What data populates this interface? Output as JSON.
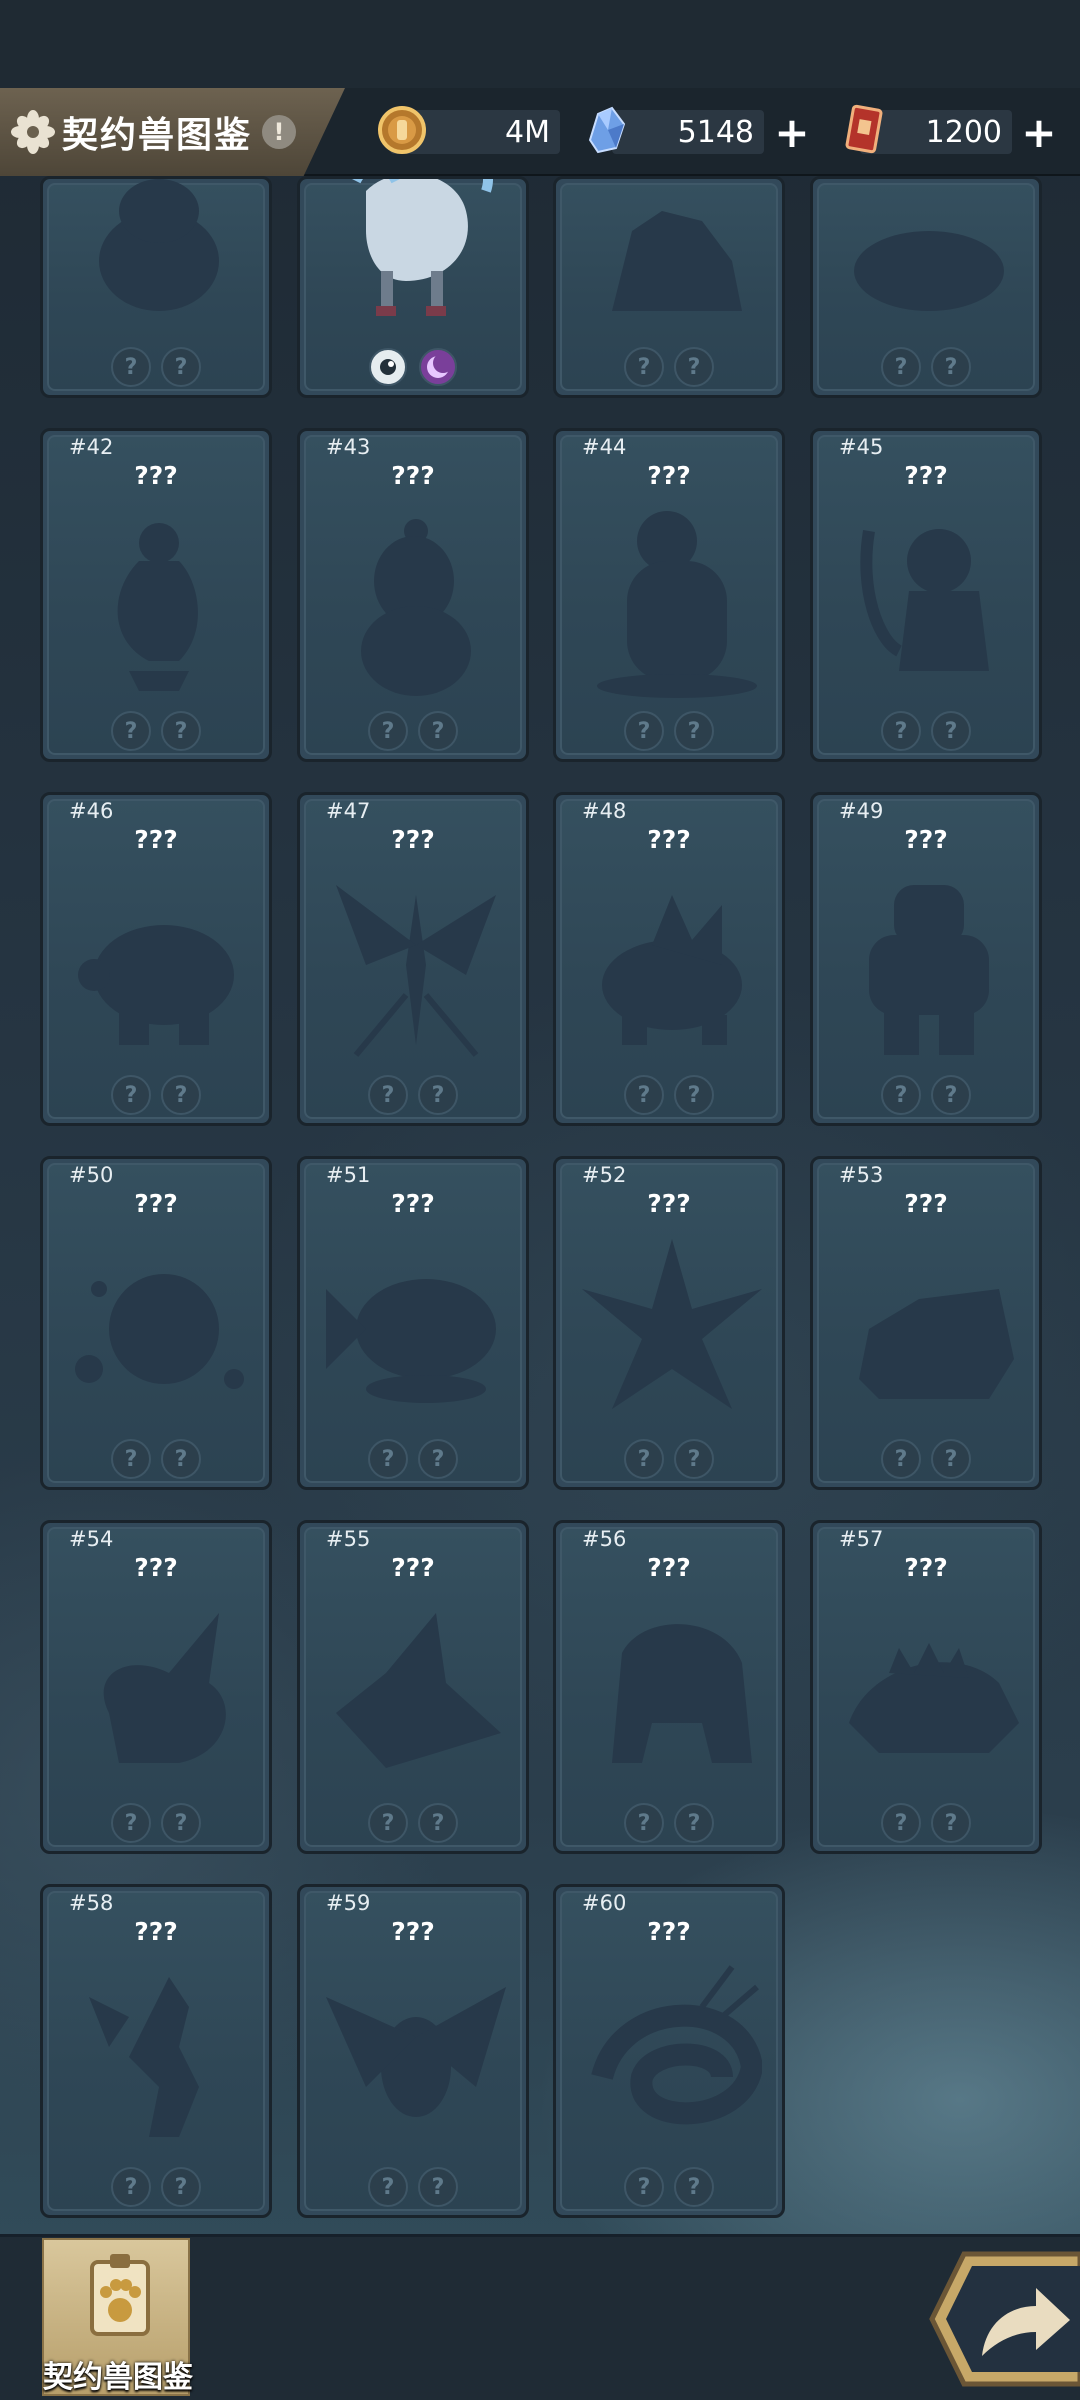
{
  "header": {
    "title": "契约兽图鉴",
    "info_glyph": "!",
    "resources": [
      {
        "icon": "gold-coin-icon",
        "value": "4M"
      },
      {
        "icon": "crystal-icon",
        "value": "5148"
      },
      {
        "icon": "ticket-card-icon",
        "value": "1200"
      }
    ],
    "plus_glyph": "+"
  },
  "grid": {
    "partial_row": [
      {
        "shape": "blob",
        "revealed": false
      },
      {
        "shape": "creature",
        "revealed": true
      },
      {
        "shape": "beast",
        "revealed": false
      },
      {
        "shape": "flat",
        "revealed": false
      }
    ],
    "cards": [
      {
        "number": "#42",
        "name": "???",
        "shape": "bird"
      },
      {
        "number": "#43",
        "name": "???",
        "shape": "bean"
      },
      {
        "number": "#44",
        "name": "???",
        "shape": "bear"
      },
      {
        "number": "#45",
        "name": "???",
        "shape": "monkey"
      },
      {
        "number": "#46",
        "name": "???",
        "shape": "turtle"
      },
      {
        "number": "#47",
        "name": "???",
        "shape": "insect"
      },
      {
        "number": "#48",
        "name": "???",
        "shape": "spiky"
      },
      {
        "number": "#49",
        "name": "???",
        "shape": "golem"
      },
      {
        "number": "#50",
        "name": "???",
        "shape": "bubble"
      },
      {
        "number": "#51",
        "name": "???",
        "shape": "fish"
      },
      {
        "number": "#52",
        "name": "???",
        "shape": "star"
      },
      {
        "number": "#53",
        "name": "???",
        "shape": "boar"
      },
      {
        "number": "#54",
        "name": "???",
        "shape": "dragon"
      },
      {
        "number": "#55",
        "name": "???",
        "shape": "wyvern"
      },
      {
        "number": "#56",
        "name": "???",
        "shape": "brute"
      },
      {
        "number": "#57",
        "name": "???",
        "shape": "ankylo"
      },
      {
        "number": "#58",
        "name": "???",
        "shape": "seahorse"
      },
      {
        "number": "#59",
        "name": "???",
        "shape": "eagle"
      },
      {
        "number": "#60",
        "name": "???",
        "shape": "serpent"
      }
    ],
    "badge_glyph": "?"
  },
  "bottom": {
    "handbook_label": "契约兽图鉴",
    "handbook_icon": "paw-scroll-icon",
    "return_icon": "return-arrow-icon"
  }
}
